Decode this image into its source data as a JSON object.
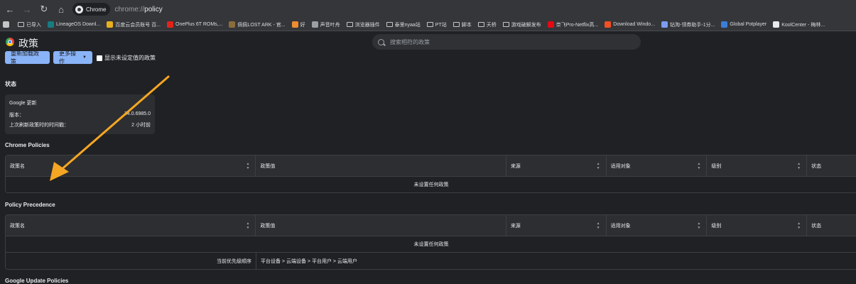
{
  "browser": {
    "back_glyph": "←",
    "forward_glyph": "→",
    "reload_glyph": "↻",
    "home_glyph": "⌂",
    "chip_label": "Chrome",
    "url_scheme": "chrome://",
    "url_path": "policy"
  },
  "bookmarks": [
    {
      "label": "",
      "icon": "apps-grid-icon",
      "color": "#c4c7c5"
    },
    {
      "label": "已导入",
      "icon": "folder-icon",
      "color": ""
    },
    {
      "label": "LineageOS Downl...",
      "icon": "lineage-icon",
      "color": "#167c80"
    },
    {
      "label": "百度云会员账号 百...",
      "icon": "baidu-icon",
      "color": "#e8b11c"
    },
    {
      "label": "OnePlus 6T ROMs,...",
      "icon": "oneplus-icon",
      "color": "#e2231a"
    },
    {
      "label": "佩佩LOST ARK - 官...",
      "icon": "lostark-icon",
      "color": "#8a6d3b"
    },
    {
      "label": "好",
      "icon": "bookmark-icon",
      "color": "#ef8c2f"
    },
    {
      "label": "声音叶舟",
      "icon": "gear-icon",
      "color": "#9aa0a6"
    },
    {
      "label": "浏览器插件",
      "icon": "folder-icon",
      "color": ""
    },
    {
      "label": "泰里nyaa站",
      "icon": "folder-icon",
      "color": ""
    },
    {
      "label": "PT站",
      "icon": "folder-icon",
      "color": ""
    },
    {
      "label": "脚本",
      "icon": "folder-icon",
      "color": ""
    },
    {
      "label": "天桥",
      "icon": "folder-icon",
      "color": ""
    },
    {
      "label": "游戏破解发布",
      "icon": "folder-icon",
      "color": ""
    },
    {
      "label": "奈飞Pro-Netflix高...",
      "icon": "netflix-icon",
      "color": "#e50914"
    },
    {
      "label": "Download Windo...",
      "icon": "windows-icon",
      "color": "#f25022"
    },
    {
      "label": "钻淘-领券助手-1分...",
      "icon": "diamond-icon",
      "color": "#7b9cf0"
    },
    {
      "label": "Global Potplayer",
      "icon": "potplayer-icon",
      "color": "#3b7dd8"
    },
    {
      "label": "KoolCenter - 梅林...",
      "icon": "koolcenter-icon",
      "color": "#e8eaed"
    }
  ],
  "header": {
    "title": "政策",
    "search_placeholder": "搜索相符的政策"
  },
  "actions": {
    "reload_label": "重新加载政策",
    "more_label": "更多操作",
    "more_caret": "▼",
    "show_unset_label": "显示未设定值的政策"
  },
  "status": {
    "section_title": "状态",
    "card_title": "Google 更新",
    "version_label": "版本：",
    "version_value": "1.3.34.0.6985.0",
    "version_visible": "34.0.6985.0",
    "refresh_label": "上次刷新政策时的时间戳：",
    "refresh_value": "2 小时前"
  },
  "chrome_policies": {
    "section_title": "Chrome Policies",
    "columns": [
      "政策名",
      "政策值",
      "来源",
      "适用对象",
      "级别",
      "状态"
    ],
    "empty_text": "未设置任何政策"
  },
  "precedence": {
    "section_title": "Policy Precedence",
    "columns": [
      "政策名",
      "政策值",
      "来源",
      "适用对象",
      "级别",
      "状态"
    ],
    "empty_text": "未设置任何政策",
    "order_label": "当前优先级顺序",
    "order_value": "平台设备 > 云端设备 > 平台用户 > 云端用户"
  },
  "google_update": {
    "section_title": "Google Update Policies"
  },
  "annotation": {
    "arrow_color": "#f5a623"
  }
}
